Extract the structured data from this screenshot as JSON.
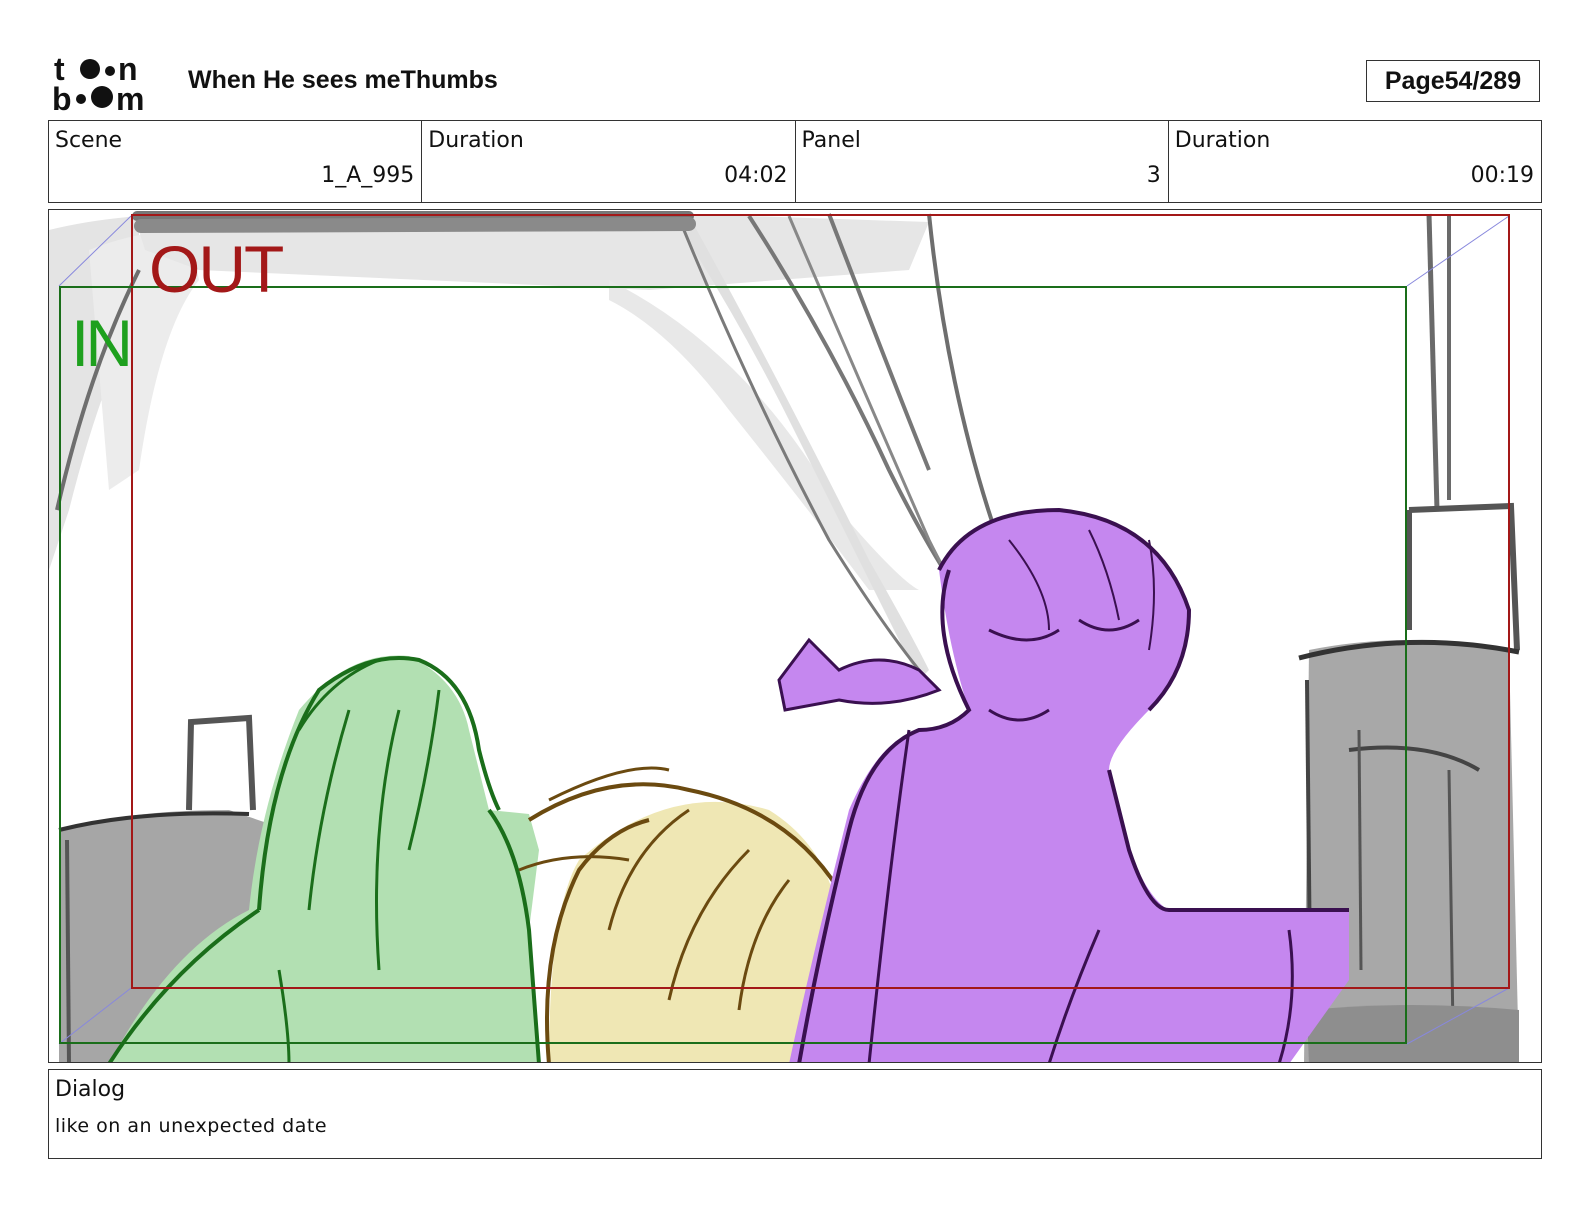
{
  "header": {
    "logo_text": "toonboom",
    "title": "When He sees meThumbs",
    "page_label": "Page",
    "page_value": "54/289"
  },
  "info": {
    "scene_label": "Scene",
    "scene_value": "1_A_995",
    "scene_duration_label": "Duration",
    "scene_duration_value": "04:02",
    "panel_label": "Panel",
    "panel_value": "3",
    "panel_duration_label": "Duration",
    "panel_duration_value": "00:19"
  },
  "panel": {
    "out_label": "OUT",
    "in_label": "IN",
    "colors": {
      "out_frame": "#a31818",
      "in_frame": "#1a6e1a",
      "in_text": "#1ea01e",
      "green_character": "#b2e0b2",
      "blond_character": "#efe7b4",
      "purple_character": "#c587ef",
      "luggage": "#a6a6a6",
      "curtain": "#e0e0e0"
    }
  },
  "dialog": {
    "label": "Dialog",
    "text": "like on an unexpected date"
  }
}
